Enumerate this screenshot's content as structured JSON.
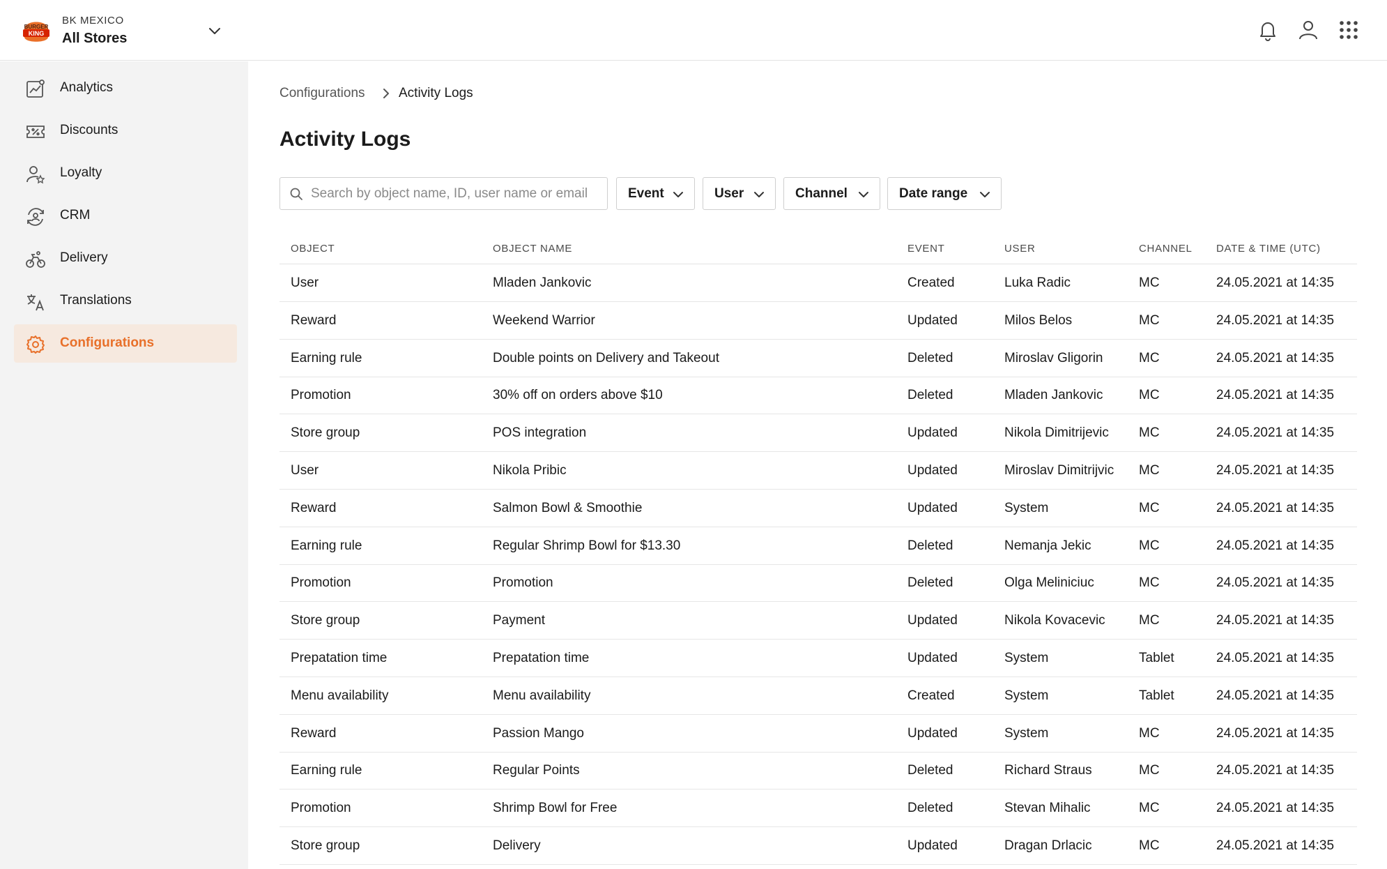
{
  "brand": {
    "logo_text_top": "BURGER",
    "logo_text_bottom": "KING",
    "region": "BK MEXICO",
    "store": "All Stores"
  },
  "header": {
    "icons": [
      "bell-icon",
      "user-icon",
      "apps-grid-icon"
    ]
  },
  "sidebar": {
    "items": [
      {
        "label": "Analytics",
        "icon": "analytics-icon",
        "active": false
      },
      {
        "label": "Discounts",
        "icon": "discount-ticket-icon",
        "active": false
      },
      {
        "label": "Loyalty",
        "icon": "loyalty-user-star-icon",
        "active": false
      },
      {
        "label": "CRM",
        "icon": "crm-refresh-user-icon",
        "active": false
      },
      {
        "label": "Delivery",
        "icon": "bike-icon",
        "active": false
      },
      {
        "label": "Translations",
        "icon": "translate-icon",
        "active": false
      },
      {
        "label": "Configurations",
        "icon": "gear-icon",
        "active": true
      }
    ]
  },
  "breadcrumb": {
    "root": "Configurations",
    "current": "Activity Logs"
  },
  "page": {
    "title": "Activity Logs"
  },
  "search": {
    "placeholder": "Search by object name, ID, user name or email",
    "value": ""
  },
  "filters": {
    "event": "Event",
    "user": "User",
    "channel": "Channel",
    "date_range": "Date range"
  },
  "table": {
    "columns": {
      "object": "OBJECT",
      "object_name": "OBJECT NAME",
      "event": "EVENT",
      "user": "USER",
      "channel": "CHANNEL",
      "datetime": "DATE & TIME (UTC)"
    },
    "rows": [
      {
        "object": "User",
        "name": "Mladen Jankovic",
        "event": "Created",
        "user": "Luka Radic",
        "channel": "MC",
        "date": "24.05.2021 at 14:35"
      },
      {
        "object": "Reward",
        "name": "Weekend Warrior",
        "event": "Updated",
        "user": "Milos Belos",
        "channel": "MC",
        "date": "24.05.2021 at 14:35"
      },
      {
        "object": "Earning rule",
        "name": "Double points on Delivery and Takeout",
        "event": "Deleted",
        "user": "Miroslav Gligorin",
        "channel": "MC",
        "date": "24.05.2021 at 14:35"
      },
      {
        "object": "Promotion",
        "name": "30% off on orders above $10",
        "event": "Deleted",
        "user": "Mladen Jankovic",
        "channel": "MC",
        "date": "24.05.2021 at 14:35"
      },
      {
        "object": "Store group",
        "name": "POS integration",
        "event": "Updated",
        "user": "Nikola Dimitrijevic",
        "channel": "MC",
        "date": "24.05.2021 at 14:35"
      },
      {
        "object": "User",
        "name": "Nikola Pribic",
        "event": "Updated",
        "user": "Miroslav Dimitrijvic",
        "channel": "MC",
        "date": "24.05.2021 at 14:35"
      },
      {
        "object": "Reward",
        "name": "Salmon Bowl & Smoothie",
        "event": "Updated",
        "user": "System",
        "channel": "MC",
        "date": "24.05.2021 at 14:35"
      },
      {
        "object": "Earning rule",
        "name": "Regular Shrimp Bowl for $13.30",
        "event": "Deleted",
        "user": "Nemanja Jekic",
        "channel": "MC",
        "date": "24.05.2021 at 14:35"
      },
      {
        "object": "Promotion",
        "name": "Promotion",
        "event": "Deleted",
        "user": "Olga Meliniciuc",
        "channel": "MC",
        "date": "24.05.2021 at 14:35"
      },
      {
        "object": "Store group",
        "name": "Payment",
        "event": "Updated",
        "user": "Nikola Kovacevic",
        "channel": "MC",
        "date": "24.05.2021 at 14:35"
      },
      {
        "object": "Prepatation time",
        "name": "Prepatation time",
        "event": "Updated",
        "user": "System",
        "channel": "Tablet",
        "date": "24.05.2021 at 14:35"
      },
      {
        "object": "Menu availability",
        "name": "Menu availability",
        "event": "Created",
        "user": "System",
        "channel": "Tablet",
        "date": "24.05.2021 at 14:35"
      },
      {
        "object": "Reward",
        "name": "Passion Mango",
        "event": "Updated",
        "user": "System",
        "channel": "MC",
        "date": "24.05.2021 at 14:35"
      },
      {
        "object": "Earning rule",
        "name": "Regular Points",
        "event": "Deleted",
        "user": "Richard Straus",
        "channel": "MC",
        "date": "24.05.2021 at 14:35"
      },
      {
        "object": "Promotion",
        "name": "Shrimp Bowl for Free",
        "event": "Deleted",
        "user": "Stevan Mihalic",
        "channel": "MC",
        "date": "24.05.2021 at 14:35"
      },
      {
        "object": "Store group",
        "name": "Delivery",
        "event": "Updated",
        "user": "Dragan Drlacic",
        "channel": "MC",
        "date": "24.05.2021 at 14:35"
      }
    ]
  },
  "colors": {
    "accent": "#e8702a",
    "active_bg": "#f6e9df",
    "sidebar_bg": "#f3f3f3",
    "border": "#e3e3e3"
  }
}
